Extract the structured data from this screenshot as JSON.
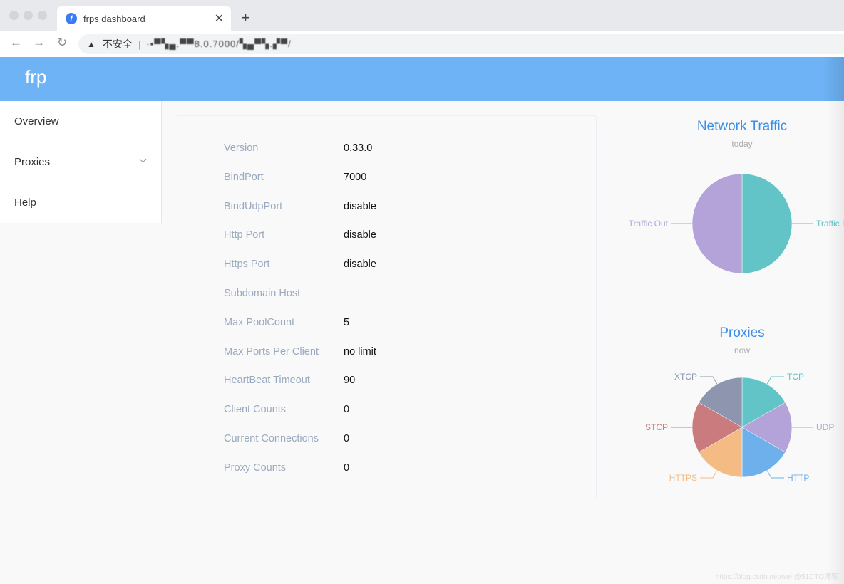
{
  "browser": {
    "tab_title": "frps dashboard",
    "favicon_letter": "f",
    "close_glyph": "✕",
    "new_tab_glyph": "+",
    "back_glyph": "←",
    "forward_glyph": "→",
    "reload_glyph": "↻",
    "warning_glyph": "▲",
    "security_label": "不安全",
    "separator": "|",
    "url": "·▪▀▚▄.▀▀8.0.7000/▚▄▀▚.▞▀/"
  },
  "header": {
    "brand": "frp",
    "color": "#6db3f5"
  },
  "sidebar": {
    "items": [
      {
        "label": "Overview"
      },
      {
        "label": "Proxies",
        "has_submenu": true
      },
      {
        "label": "Help"
      }
    ]
  },
  "overview": {
    "rows": [
      {
        "label": "Version",
        "value": "0.33.0"
      },
      {
        "label": "BindPort",
        "value": "7000"
      },
      {
        "label": "BindUdpPort",
        "value": "disable"
      },
      {
        "label": "Http Port",
        "value": "disable"
      },
      {
        "label": "Https Port",
        "value": "disable"
      },
      {
        "label": "Subdomain Host",
        "value": ""
      },
      {
        "label": "Max PoolCount",
        "value": "5"
      },
      {
        "label": "Max Ports Per Client",
        "value": "no limit"
      },
      {
        "label": "HeartBeat Timeout",
        "value": "90"
      },
      {
        "label": "Client Counts",
        "value": "0"
      },
      {
        "label": "Current Connections",
        "value": "0"
      },
      {
        "label": "Proxy Counts",
        "value": "0"
      }
    ]
  },
  "chart_data": [
    {
      "type": "pie",
      "title": "Network Traffic",
      "subtitle": "today",
      "slices": [
        {
          "name": "Traffic In",
          "value": 1,
          "color": "#62c4c6"
        },
        {
          "name": "Traffic Out",
          "value": 1,
          "color": "#b3a3d9"
        }
      ]
    },
    {
      "type": "pie",
      "title": "Proxies",
      "subtitle": "now",
      "slices": [
        {
          "name": "TCP",
          "value": 1,
          "color": "#62c4c6"
        },
        {
          "name": "UDP",
          "value": 1,
          "color": "#b3a3d9"
        },
        {
          "name": "HTTP",
          "value": 1,
          "color": "#6db0ec"
        },
        {
          "name": "HTTPS",
          "value": 1,
          "color": "#f5bb85"
        },
        {
          "name": "STCP",
          "value": 1,
          "color": "#c97b7d"
        },
        {
          "name": "XTCP",
          "value": 1,
          "color": "#8d96ae"
        }
      ]
    }
  ],
  "watermark": "https://blog.csdn.net/wei @51CTO博客"
}
